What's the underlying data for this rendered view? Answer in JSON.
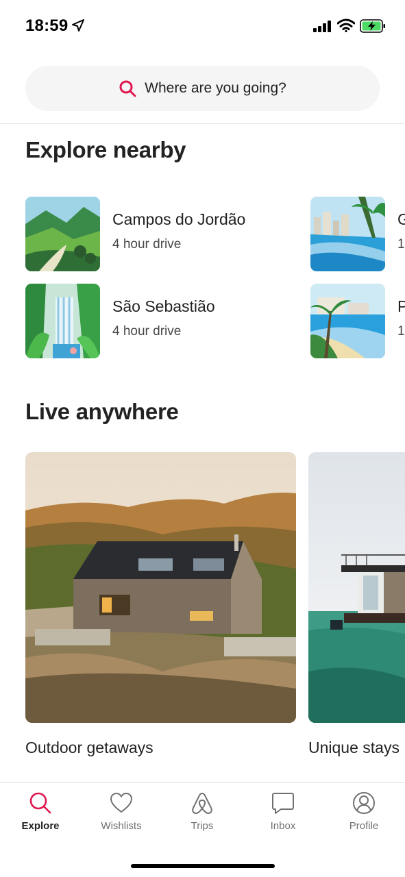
{
  "status_bar": {
    "time": "18:59",
    "icons": [
      "location-arrow-icon",
      "cellular-signal-icon",
      "wifi-icon",
      "battery-charging-icon"
    ]
  },
  "search": {
    "placeholder": "Where are you going?",
    "icon": "search-icon"
  },
  "explore_nearby": {
    "title": "Explore nearby",
    "items": [
      {
        "name": "Campos do Jordão",
        "subtitle": "4 hour drive"
      },
      {
        "name": "São Sebastião",
        "subtitle": "4 hour drive"
      },
      {
        "name": "G",
        "subtitle": "1"
      },
      {
        "name": "P",
        "subtitle": "1"
      }
    ]
  },
  "live_anywhere": {
    "title": "Live anywhere",
    "cards": [
      {
        "label": "Outdoor getaways"
      },
      {
        "label": "Unique stays"
      }
    ]
  },
  "tab_bar": {
    "tabs": [
      {
        "label": "Explore",
        "icon": "search-icon",
        "active": true
      },
      {
        "label": "Wishlists",
        "icon": "heart-icon",
        "active": false
      },
      {
        "label": "Trips",
        "icon": "airbnb-logo-icon",
        "active": false
      },
      {
        "label": "Inbox",
        "icon": "chat-bubble-icon",
        "active": false
      },
      {
        "label": "Profile",
        "icon": "user-circle-icon",
        "active": false
      }
    ]
  },
  "colors": {
    "accent": "#e0174f",
    "text": "#222222",
    "muted": "#717171",
    "search_bg": "#f5f5f5"
  }
}
